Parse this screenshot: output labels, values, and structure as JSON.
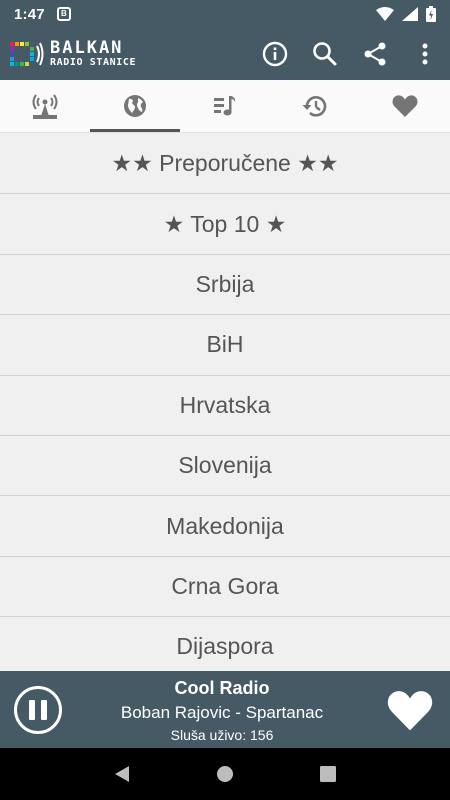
{
  "status_bar": {
    "time": "1:47",
    "app_icon_letter": "B",
    "icons": [
      "wifi-icon",
      "signal-icon",
      "battery-icon"
    ]
  },
  "app_bar": {
    "logo_line1": "BALKAN",
    "logo_line2": "RADIO STANICE",
    "actions": [
      "info-icon",
      "search-icon",
      "share-icon",
      "more-vert-icon"
    ]
  },
  "tabs": [
    {
      "icon": "radio-tower-icon",
      "active": false
    },
    {
      "icon": "globe-icon",
      "active": true
    },
    {
      "icon": "music-list-icon",
      "active": false
    },
    {
      "icon": "history-icon",
      "active": false
    },
    {
      "icon": "heart-icon",
      "active": false
    }
  ],
  "list": {
    "items": [
      "★★ Preporučene ★★",
      "★ Top 10 ★",
      "Srbija",
      "BiH",
      "Hrvatska",
      "Slovenija",
      "Makedonija",
      "Crna Gora",
      "Dijaspora"
    ]
  },
  "player": {
    "station": "Cool Radio",
    "track": "Boban Rajovic - Spartanac",
    "listeners": "Sluša uživo: 156",
    "pause_icon": "pause-icon",
    "favorite_icon": "heart-icon"
  },
  "nav_bar": {
    "icons": [
      "back-icon",
      "home-icon",
      "recents-icon"
    ]
  },
  "colors": {
    "bar": "#455a64",
    "list_bg": "#f0f0f0",
    "list_text": "#555555",
    "tab_icon": "#757575"
  }
}
